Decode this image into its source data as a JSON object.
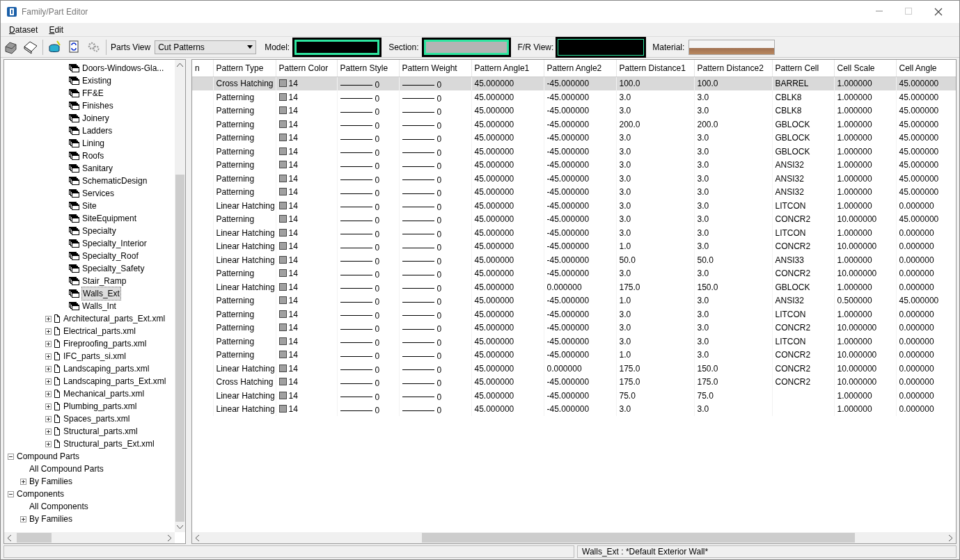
{
  "window": {
    "title": "Family/Part Editor"
  },
  "menu": [
    {
      "label": "Dataset"
    },
    {
      "label": "Edit"
    }
  ],
  "toolbar": {
    "parts_view_label": "Parts View",
    "parts_view_value": "Cut Patterns",
    "swatches": [
      {
        "label": "Model:",
        "kind": "color",
        "color": "#000000"
      },
      {
        "label": "Section:",
        "kind": "color",
        "color": "#b4b4b4"
      },
      {
        "label": "F/R View:",
        "kind": "outline",
        "color": "#000000"
      },
      {
        "label": "Material:",
        "kind": "image"
      }
    ]
  },
  "tree": {
    "family_items": [
      {
        "label": "Doors-Windows-Gla...",
        "selected": false
      },
      {
        "label": "Existing",
        "selected": false
      },
      {
        "label": "FF&E",
        "selected": false
      },
      {
        "label": "Finishes",
        "selected": false
      },
      {
        "label": "Joinery",
        "selected": false
      },
      {
        "label": "Ladders",
        "selected": false
      },
      {
        "label": "Lining",
        "selected": false
      },
      {
        "label": "Roofs",
        "selected": false
      },
      {
        "label": "Sanitary",
        "selected": false
      },
      {
        "label": "SchematicDesign",
        "selected": false
      },
      {
        "label": "Services",
        "selected": false
      },
      {
        "label": "Site",
        "selected": false
      },
      {
        "label": "SiteEquipment",
        "selected": false
      },
      {
        "label": "Specialty",
        "selected": false
      },
      {
        "label": "Specialty_Interior",
        "selected": false
      },
      {
        "label": "Specialty_Roof",
        "selected": false
      },
      {
        "label": "Specialty_Safety",
        "selected": false
      },
      {
        "label": "Stair_Ramp",
        "selected": false
      },
      {
        "label": "Walls_Ext",
        "selected": true
      },
      {
        "label": "Walls_Int",
        "selected": false
      }
    ],
    "file_items": [
      {
        "label": "Architectural_parts_Ext.xml",
        "expanded": false
      },
      {
        "label": "Electrical_parts.xml",
        "expanded": false
      },
      {
        "label": "Fireproofing_parts.xml",
        "expanded": false
      },
      {
        "label": "IFC_parts_si.xml",
        "expanded": false
      },
      {
        "label": "Landscaping_parts.xml",
        "expanded": false
      },
      {
        "label": "Landscaping_parts_Ext.xml",
        "expanded": false
      },
      {
        "label": "Mechanical_parts.xml",
        "expanded": false
      },
      {
        "label": "Plumbing_parts.xml",
        "expanded": false
      },
      {
        "label": "Spaces_parts.xml",
        "expanded": false
      },
      {
        "label": "Structural_parts.xml",
        "expanded": false
      },
      {
        "label": "Structural_parts_Ext.xml",
        "expanded": false
      }
    ],
    "groups": [
      {
        "label": "Compound Parts",
        "expanded": true,
        "children": [
          {
            "label": "All Compound Parts",
            "kind": "leaf"
          },
          {
            "label": "By Families",
            "kind": "branch",
            "expanded": false
          }
        ]
      },
      {
        "label": "Components",
        "expanded": true,
        "children": [
          {
            "label": "All Components",
            "kind": "leaf"
          },
          {
            "label": "By Families",
            "kind": "branch",
            "expanded": false
          }
        ]
      }
    ]
  },
  "table": {
    "columns": [
      "n",
      "Pattern Type",
      "Pattern Color",
      "Pattern Style",
      "Pattern Weight",
      "Pattern Angle1",
      "Pattern Angle2",
      "Pattern Distance1",
      "Pattern Distance2",
      "Pattern Cell",
      "Cell Scale",
      "Cell Angle"
    ],
    "rows": [
      {
        "selected": true,
        "type": "Cross Hatching",
        "color_index": "14",
        "style": "0",
        "weight": "0",
        "angle1": "45.000000",
        "angle2": "-45.000000",
        "distance1": "100.0",
        "distance2": "100.0",
        "cell": "BARREL",
        "scale": "1.000000",
        "cell_angle": "45.000000"
      },
      {
        "selected": false,
        "type": "Patterning",
        "color_index": "14",
        "style": "0",
        "weight": "0",
        "angle1": "45.000000",
        "angle2": "-45.000000",
        "distance1": "3.0",
        "distance2": "3.0",
        "cell": "CBLK8",
        "scale": "1.000000",
        "cell_angle": "45.000000"
      },
      {
        "selected": false,
        "type": "Patterning",
        "color_index": "14",
        "style": "0",
        "weight": "0",
        "angle1": "45.000000",
        "angle2": "-45.000000",
        "distance1": "3.0",
        "distance2": "3.0",
        "cell": "CBLK8",
        "scale": "1.000000",
        "cell_angle": "45.000000"
      },
      {
        "selected": false,
        "type": "Patterning",
        "color_index": "14",
        "style": "0",
        "weight": "0",
        "angle1": "45.000000",
        "angle2": "-45.000000",
        "distance1": "200.0",
        "distance2": "200.0",
        "cell": "GBLOCK",
        "scale": "1.000000",
        "cell_angle": "45.000000"
      },
      {
        "selected": false,
        "type": "Patterning",
        "color_index": "14",
        "style": "0",
        "weight": "0",
        "angle1": "45.000000",
        "angle2": "-45.000000",
        "distance1": "3.0",
        "distance2": "3.0",
        "cell": "GBLOCK",
        "scale": "1.000000",
        "cell_angle": "45.000000"
      },
      {
        "selected": false,
        "type": "Patterning",
        "color_index": "14",
        "style": "0",
        "weight": "0",
        "angle1": "45.000000",
        "angle2": "-45.000000",
        "distance1": "3.0",
        "distance2": "3.0",
        "cell": "GBLOCK",
        "scale": "1.000000",
        "cell_angle": "45.000000"
      },
      {
        "selected": false,
        "type": "Patterning",
        "color_index": "14",
        "style": "0",
        "weight": "0",
        "angle1": "45.000000",
        "angle2": "-45.000000",
        "distance1": "3.0",
        "distance2": "3.0",
        "cell": "ANSI32",
        "scale": "1.000000",
        "cell_angle": "45.000000"
      },
      {
        "selected": false,
        "type": "Patterning",
        "color_index": "14",
        "style": "0",
        "weight": "0",
        "angle1": "45.000000",
        "angle2": "-45.000000",
        "distance1": "3.0",
        "distance2": "3.0",
        "cell": "ANSI32",
        "scale": "1.000000",
        "cell_angle": "45.000000"
      },
      {
        "selected": false,
        "type": "Patterning",
        "color_index": "14",
        "style": "0",
        "weight": "0",
        "angle1": "45.000000",
        "angle2": "-45.000000",
        "distance1": "3.0",
        "distance2": "3.0",
        "cell": "ANSI32",
        "scale": "1.000000",
        "cell_angle": "45.000000"
      },
      {
        "selected": false,
        "type": "Linear Hatching",
        "color_index": "14",
        "style": "0",
        "weight": "0",
        "angle1": "45.000000",
        "angle2": "-45.000000",
        "distance1": "3.0",
        "distance2": "3.0",
        "cell": "LITCON",
        "scale": "1.000000",
        "cell_angle": "0.000000"
      },
      {
        "selected": false,
        "type": "Patterning",
        "color_index": "14",
        "style": "0",
        "weight": "0",
        "angle1": "45.000000",
        "angle2": "-45.000000",
        "distance1": "3.0",
        "distance2": "3.0",
        "cell": "CONCR2",
        "scale": "10.000000",
        "cell_angle": "45.000000"
      },
      {
        "selected": false,
        "type": "Linear Hatching",
        "color_index": "14",
        "style": "0",
        "weight": "0",
        "angle1": "45.000000",
        "angle2": "-45.000000",
        "distance1": "3.0",
        "distance2": "3.0",
        "cell": "LITCON",
        "scale": "1.000000",
        "cell_angle": "0.000000"
      },
      {
        "selected": false,
        "type": "Linear Hatching",
        "color_index": "14",
        "style": "0",
        "weight": "0",
        "angle1": "45.000000",
        "angle2": "-45.000000",
        "distance1": "1.0",
        "distance2": "3.0",
        "cell": "CONCR2",
        "scale": "10.000000",
        "cell_angle": "0.000000"
      },
      {
        "selected": false,
        "type": "Linear Hatching",
        "color_index": "14",
        "style": "0",
        "weight": "0",
        "angle1": "45.000000",
        "angle2": "-45.000000",
        "distance1": "50.0",
        "distance2": "50.0",
        "cell": "ANSI33",
        "scale": "1.000000",
        "cell_angle": "0.000000"
      },
      {
        "selected": false,
        "type": "Patterning",
        "color_index": "14",
        "style": "0",
        "weight": "0",
        "angle1": "45.000000",
        "angle2": "-45.000000",
        "distance1": "3.0",
        "distance2": "3.0",
        "cell": "CONCR2",
        "scale": "10.000000",
        "cell_angle": "0.000000"
      },
      {
        "selected": false,
        "type": "Linear Hatching",
        "color_index": "14",
        "style": "0",
        "weight": "0",
        "angle1": "45.000000",
        "angle2": "0.000000",
        "distance1": "175.0",
        "distance2": "150.0",
        "cell": "GBLOCK",
        "scale": "1.000000",
        "cell_angle": "0.000000"
      },
      {
        "selected": false,
        "type": "Patterning",
        "color_index": "14",
        "style": "0",
        "weight": "0",
        "angle1": "45.000000",
        "angle2": "-45.000000",
        "distance1": "1.0",
        "distance2": "3.0",
        "cell": "ANSI32",
        "scale": "0.500000",
        "cell_angle": "45.000000"
      },
      {
        "selected": false,
        "type": "Patterning",
        "color_index": "14",
        "style": "0",
        "weight": "0",
        "angle1": "45.000000",
        "angle2": "-45.000000",
        "distance1": "3.0",
        "distance2": "3.0",
        "cell": "LITCON",
        "scale": "1.000000",
        "cell_angle": "0.000000"
      },
      {
        "selected": false,
        "type": "Patterning",
        "color_index": "14",
        "style": "0",
        "weight": "0",
        "angle1": "45.000000",
        "angle2": "-45.000000",
        "distance1": "3.0",
        "distance2": "3.0",
        "cell": "CONCR2",
        "scale": "10.000000",
        "cell_angle": "0.000000"
      },
      {
        "selected": false,
        "type": "Patterning",
        "color_index": "14",
        "style": "0",
        "weight": "0",
        "angle1": "45.000000",
        "angle2": "-45.000000",
        "distance1": "3.0",
        "distance2": "3.0",
        "cell": "LITCON",
        "scale": "1.000000",
        "cell_angle": "0.000000"
      },
      {
        "selected": false,
        "type": "Patterning",
        "color_index": "14",
        "style": "0",
        "weight": "0",
        "angle1": "45.000000",
        "angle2": "-45.000000",
        "distance1": "1.0",
        "distance2": "3.0",
        "cell": "CONCR2",
        "scale": "10.000000",
        "cell_angle": "0.000000"
      },
      {
        "selected": false,
        "type": "Linear Hatching",
        "color_index": "14",
        "style": "0",
        "weight": "0",
        "angle1": "45.000000",
        "angle2": "0.000000",
        "distance1": "175.0",
        "distance2": "150.0",
        "cell": "CONCR2",
        "scale": "10.000000",
        "cell_angle": "0.000000"
      },
      {
        "selected": false,
        "type": "Cross Hatching",
        "color_index": "14",
        "style": "0",
        "weight": "0",
        "angle1": "45.000000",
        "angle2": "-45.000000",
        "distance1": "175.0",
        "distance2": "175.0",
        "cell": "CONCR2",
        "scale": "10.000000",
        "cell_angle": "0.000000"
      },
      {
        "selected": false,
        "type": "Linear Hatching",
        "color_index": "14",
        "style": "0",
        "weight": "0",
        "angle1": "45.000000",
        "angle2": "-45.000000",
        "distance1": "75.0",
        "distance2": "75.0",
        "scale": "1.000000",
        "cell_angle": "0.000000"
      },
      {
        "selected": false,
        "type": "Linear Hatching",
        "color_index": "14",
        "style": "0",
        "weight": "0",
        "angle1": "45.000000",
        "angle2": "-45.000000",
        "distance1": "3.0",
        "distance2": "3.0",
        "scale": "1.000000",
        "cell_angle": "0.000000"
      }
    ]
  },
  "status_bar": {
    "text": "Walls_Ext : *Default Exterior Wall*"
  }
}
